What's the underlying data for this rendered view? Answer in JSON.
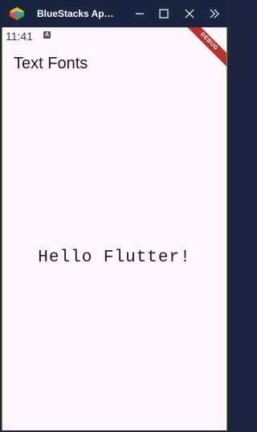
{
  "window": {
    "title": "BlueStacks Ap…",
    "colors": {
      "titlebar": "#1c2540",
      "accent": "#7c9a2e"
    }
  },
  "titlebar_buttons": {
    "minimize": "minimize-icon",
    "maximize": "maximize-icon",
    "close": "close-icon",
    "more": "double-chevron-right-icon"
  },
  "statusbar": {
    "time": "11:41",
    "notification_icon_label": "A"
  },
  "appbar": {
    "title": "Text Fonts"
  },
  "body": {
    "text": "Hello Flutter!"
  },
  "debug_banner": {
    "label": "DEBUG",
    "color": "#b8312f"
  }
}
